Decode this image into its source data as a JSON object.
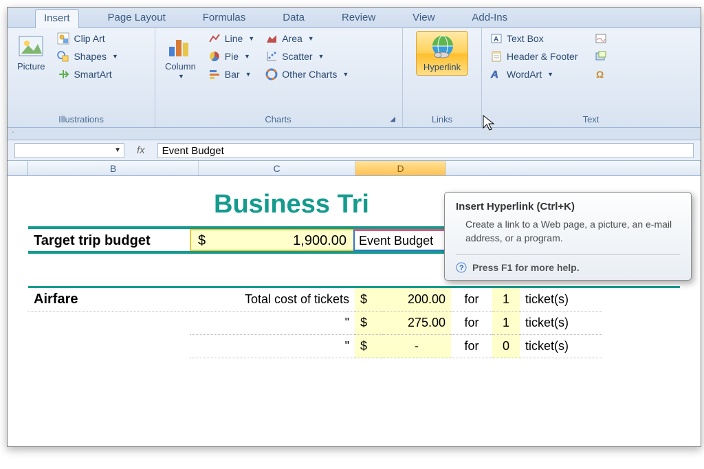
{
  "tabs": {
    "insert": "Insert",
    "page_layout": "Page Layout",
    "formulas": "Formulas",
    "data": "Data",
    "review": "Review",
    "view": "View",
    "addins": "Add-Ins"
  },
  "ribbon": {
    "illustrations": {
      "title": "Illustrations",
      "picture": "Picture",
      "clipart": "Clip Art",
      "shapes": "Shapes",
      "smartart": "SmartArt"
    },
    "charts": {
      "title": "Charts",
      "column": "Column",
      "line": "Line",
      "pie": "Pie",
      "bar": "Bar",
      "area": "Area",
      "scatter": "Scatter",
      "other": "Other Charts"
    },
    "links": {
      "title": "Links",
      "hyperlink": "Hyperlink"
    },
    "text": {
      "title": "Text",
      "textbox": "Text Box",
      "headerfooter": "Header & Footer",
      "wordart": "WordArt"
    }
  },
  "formula_bar": {
    "fx": "fx",
    "value": "Event Budget"
  },
  "columns": {
    "b": "B",
    "c": "C",
    "d": "D"
  },
  "sheet": {
    "title": "Business Tri",
    "target_label": "Target trip budget",
    "target_currency": "$",
    "target_amount": "1,900.00",
    "active_cell": "Event Budget",
    "airfare": {
      "label": "Airfare",
      "desc": "Total cost of tickets",
      "ditto": "\"",
      "rows": [
        {
          "cur": "$",
          "amt": "200.00",
          "for": "for",
          "cnt": "1",
          "unit": "ticket(s)"
        },
        {
          "cur": "$",
          "amt": "275.00",
          "for": "for",
          "cnt": "1",
          "unit": "ticket(s)"
        },
        {
          "cur": "$",
          "amt": "-",
          "for": "for",
          "cnt": "0",
          "unit": "ticket(s)"
        }
      ]
    }
  },
  "tooltip": {
    "title": "Insert Hyperlink (Ctrl+K)",
    "body": "Create a link to a Web page, a picture, an e-mail address, or a program.",
    "help": "Press F1 for more help."
  },
  "subbar": "-"
}
